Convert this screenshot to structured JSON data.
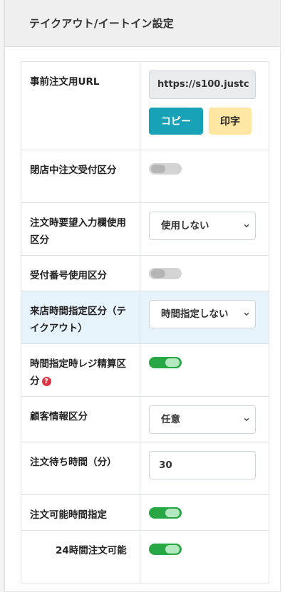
{
  "card": {
    "title": "テイクアウト/イートイン設定"
  },
  "rows": {
    "url": {
      "label": "事前注文用URL",
      "value": "https://s100.justc",
      "copy_button": "コピー",
      "print_button": "印字"
    },
    "closed_orders": {
      "label": "閉店中注文受付区分",
      "toggle_on": false
    },
    "desired_time_field": {
      "label": "注文時要望入力欄使用区分",
      "selected": "使用しない"
    },
    "reception_number": {
      "label": "受付番号使用区分",
      "toggle_on": false
    },
    "visit_time": {
      "label": "来店時間指定区分（テイクアウト）",
      "selected": "時間指定しない"
    },
    "register_settlement": {
      "label": "時間指定時レジ精算区分",
      "help_icon": "?",
      "toggle_on": true
    },
    "customer_info": {
      "label": "顧客情報区分",
      "selected": "任意"
    },
    "wait_time": {
      "label": "注文待ち時間（分）",
      "value": "30"
    },
    "order_time": {
      "label": "注文可能時間指定",
      "toggle_on": true
    },
    "order_24h": {
      "label": "24時間注文可能",
      "toggle_on": true
    }
  },
  "colors": {
    "toggle_on": "#28a745",
    "toggle_off": "#d4d4d4",
    "copy_button": "#17a2b8",
    "print_button": "#ffe7a3",
    "highlight_row": "#e7f3fb",
    "help_icon": "#dc3545"
  },
  "icons": {
    "help": "question-circle-icon",
    "caret": "chevron-down-icon"
  }
}
